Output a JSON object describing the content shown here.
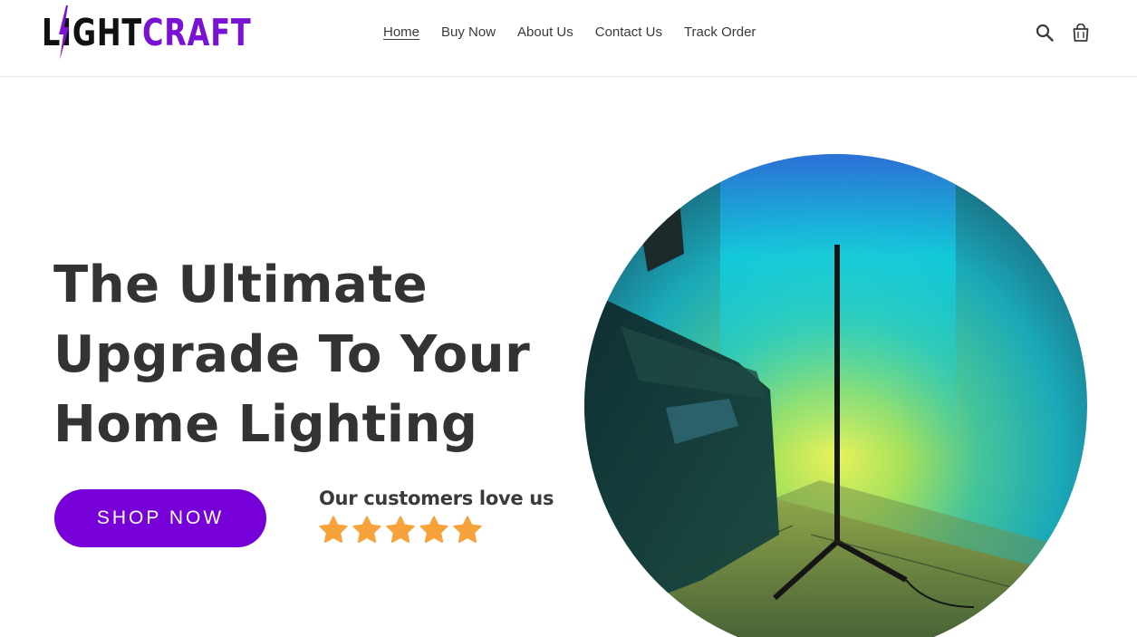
{
  "brand": {
    "logo_part1": "LIGHT",
    "logo_part2": "CRAFT",
    "logo_color_dark": "#111111",
    "logo_color_accent": "#7a12d6"
  },
  "nav": {
    "items": [
      {
        "label": "Home",
        "active": true
      },
      {
        "label": "Buy Now",
        "active": false
      },
      {
        "label": "About Us",
        "active": false
      },
      {
        "label": "Contact Us",
        "active": false
      },
      {
        "label": "Track Order",
        "active": false
      }
    ]
  },
  "header_icons": [
    "search-icon",
    "cart-icon"
  ],
  "hero": {
    "title_lines": [
      "The Ultimate",
      "Upgrade To Your",
      "Home Lighting"
    ],
    "cta_label": "SHOP NOW",
    "cta_color": "#7700d9",
    "reviews_label": "Our customers love us",
    "rating": 5,
    "rating_max": 5,
    "star_color": "#f7a23b",
    "image_icon": "floor-lamp-photo"
  }
}
